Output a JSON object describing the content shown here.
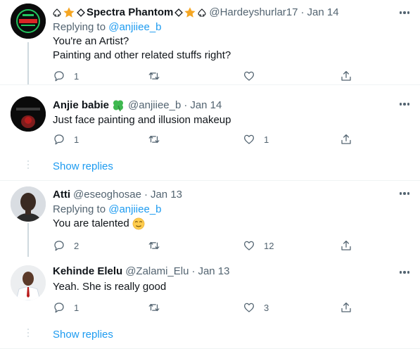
{
  "tweets": [
    {
      "name": "Spectra Phantom",
      "handle": "@Hardeyshurlar17",
      "dot": "·",
      "date": "Jan 14",
      "replying_prefix": "Replying to ",
      "replying_to": "@anjiiee_b",
      "lines": [
        "You're an Artist?",
        "Painting and other related stuffs right?"
      ],
      "replies": "1",
      "retweets": "",
      "likes": "",
      "avatar_colors": [
        "#0b0b0b",
        "#22c55e",
        "#dc2626"
      ]
    },
    {
      "name": "Anjie babie",
      "handle": "@anjiiee_b",
      "dot": "·",
      "date": "Jan 14",
      "lines": [
        "Just face painting and illusion makeup"
      ],
      "replies": "1",
      "retweets": "",
      "likes": "1",
      "avatar_colors": [
        "#0a0a0a",
        "#b91c1c"
      ]
    },
    {
      "name": "Atti",
      "handle": "@eseoghosae",
      "dot": "·",
      "date": "Jan 13",
      "replying_prefix": "Replying to ",
      "replying_to": "@anjiiee_b",
      "lines": [
        "You are talented"
      ],
      "replies": "2",
      "retweets": "",
      "likes": "12",
      "avatar_colors": [
        "#d1d5db",
        "#3a2a22"
      ]
    },
    {
      "name": "Kehinde Elelu",
      "handle": "@Zalami_Elu",
      "dot": "·",
      "date": "Jan 13",
      "lines": [
        "Yeah. She is really good"
      ],
      "replies": "1",
      "retweets": "",
      "likes": "3",
      "avatar_colors": [
        "#e5e7eb",
        "#5b3a29"
      ]
    }
  ],
  "show_replies_1": "Show replies",
  "show_replies_2": "Show replies",
  "colors": {
    "accent": "#1d9bf0",
    "muted": "#536471",
    "text": "#0f1419",
    "clover": "#3fb950",
    "star": "#f5a623"
  }
}
